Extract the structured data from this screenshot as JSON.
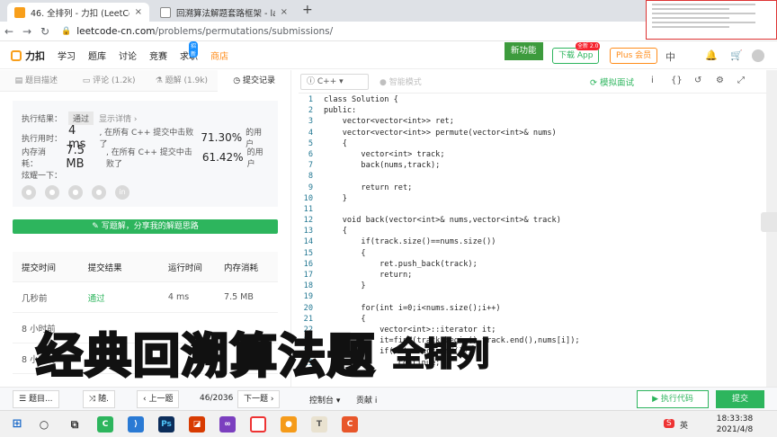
{
  "browser": {
    "tabs": [
      {
        "title": "46. 全排列 - 力扣 (LeetCode)",
        "close": "×"
      },
      {
        "title": "回溯算法解题套路框架 - labuladong",
        "close": "×"
      }
    ],
    "new_tab": "+",
    "nav": {
      "back": "←",
      "forward": "→",
      "reload": "↻"
    },
    "url_host": "leetcode-cn.com",
    "url_path": "/problems/permutations/submissions/"
  },
  "header": {
    "logo": "力扣",
    "nav": [
      "学习",
      "题库",
      "讨论",
      "竞赛",
      "求职",
      "商店"
    ],
    "job_badge": "招新",
    "new_feature": "新功能",
    "download_app": "下载 App",
    "download_badge": "全新 2.0",
    "plus": "Plus 会员",
    "lang": "中",
    "notif_badge": "99+"
  },
  "left_tabs": [
    {
      "label": "题目描述",
      "icon": "doc-icon"
    },
    {
      "label": "评论 (1.2k)",
      "icon": "comment-icon"
    },
    {
      "label": "题解 (1.9k)",
      "icon": "solution-icon"
    },
    {
      "label": "提交记录",
      "icon": "history-icon"
    }
  ],
  "result": {
    "label_result": "执行结果：",
    "status": "通过",
    "details_link": "显示详情 ›",
    "label_time": "执行用时：",
    "time": "4 ms",
    "time_text1": ", 在所有 C++ 提交中击败了",
    "time_pct": "71.30%",
    "time_text2": "的用户",
    "label_mem": "内存消耗：",
    "mem": "7.5 MB",
    "mem_text1": ", 在所有 C++ 提交中击败了",
    "mem_pct": "61.42%",
    "mem_text2": "的用户",
    "share_label": "炫耀一下：",
    "write_btn": "✎ 写题解，分享我的解题思路"
  },
  "table": {
    "headers": [
      "提交时间",
      "提交结果",
      "运行时间",
      "内存消耗"
    ],
    "rows": [
      {
        "time": "几秒前",
        "result": "通过",
        "runtime": "4 ms",
        "mem": "7.5 MB"
      },
      {
        "time": "8 小时前",
        "result": "",
        "runtime": "",
        "mem": ""
      },
      {
        "time": "8 小时前",
        "result": "",
        "runtime": "",
        "mem": ""
      }
    ]
  },
  "editor": {
    "language": "C++",
    "mode": "智能模式",
    "simulate": "模拟面试",
    "lines": [
      "class Solution {",
      "public:",
      "    vector<vector<int>> ret;",
      "    vector<vector<int>> permute(vector<int>& nums)",
      "    {",
      "        vector<int> track;",
      "        back(nums,track);",
      "",
      "        return ret;",
      "    }",
      "",
      "    void back(vector<int>& nums,vector<int>& track)",
      "    {",
      "        if(track.size()==nums.size())",
      "        {",
      "            ret.push_back(track);",
      "            return;",
      "        }",
      "",
      "        for(int i=0;i<nums.size();i++)",
      "        {",
      "            vector<int>::iterator it;",
      "            it=find(track.begin(),track.end(),nums[i]);",
      "            if(it!=track.end())",
      "                continue;"
    ]
  },
  "bottom": {
    "problems": "题目...",
    "random": "随.",
    "prev": "上一题",
    "counter": "46/2036",
    "next": "下一题",
    "console": "控制台",
    "contribute": "贡献 i",
    "run": "执行代码",
    "submit": "提交"
  },
  "banner": {
    "main": "经典回溯算法题",
    "sub": "全排列"
  },
  "taskbar": {
    "time": "18:33:38",
    "date": "2021/4/8",
    "ime": "英"
  }
}
